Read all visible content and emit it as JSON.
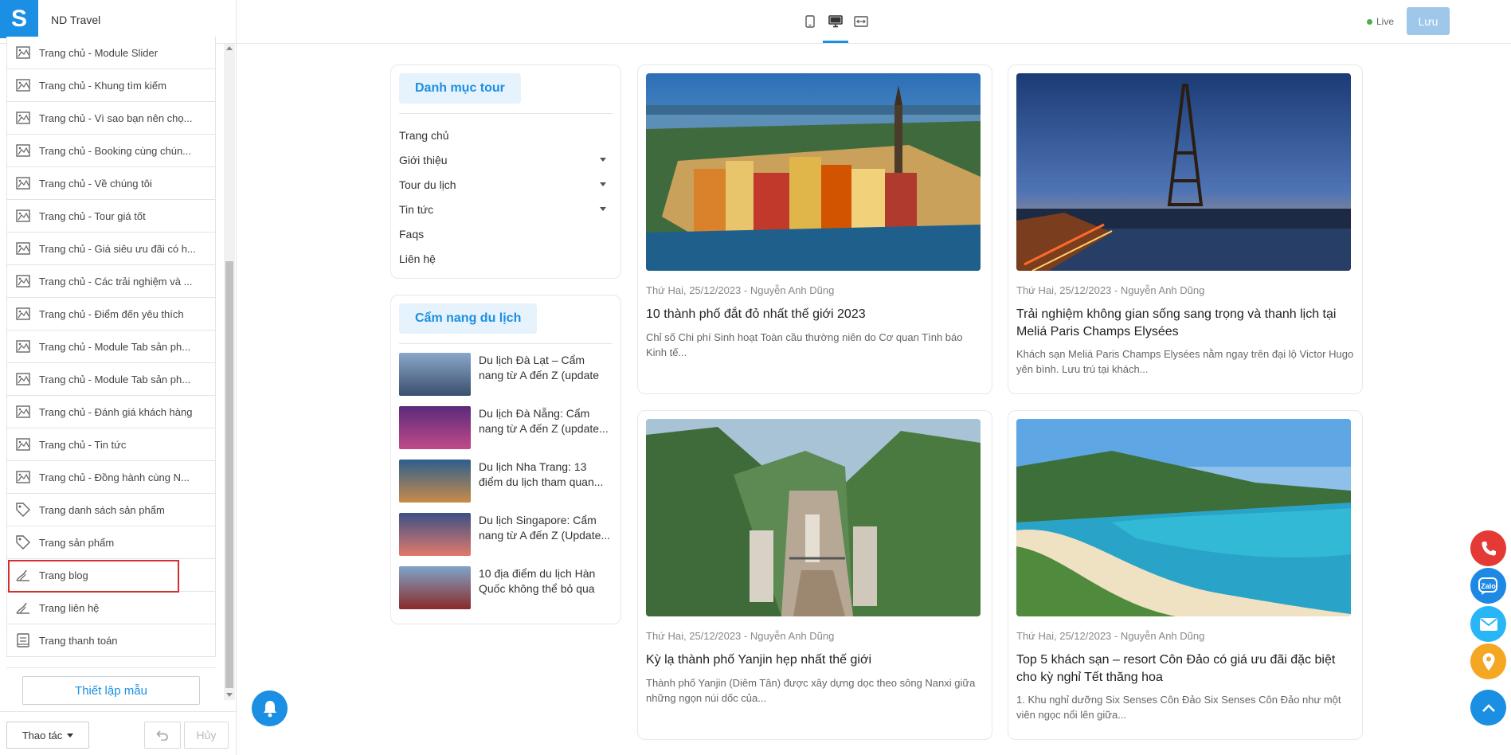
{
  "app": {
    "name": "ND Travel",
    "logo_letter": "S",
    "live_label": "Live",
    "save_label": "Lưu"
  },
  "sidebar": {
    "items": [
      {
        "label": "Trang chủ - Module Slider",
        "icon": "image-icon"
      },
      {
        "label": "Trang chủ - Khung tìm kiếm",
        "icon": "image-icon"
      },
      {
        "label": "Trang chủ - Vì sao bạn nên chọ...",
        "icon": "image-icon"
      },
      {
        "label": "Trang chủ - Booking cùng chún...",
        "icon": "image-icon"
      },
      {
        "label": "Trang chủ - Về chúng tôi",
        "icon": "image-icon"
      },
      {
        "label": "Trang chủ - Tour giá tốt",
        "icon": "image-icon"
      },
      {
        "label": "Trang chủ - Giá siêu ưu đãi có h...",
        "icon": "image-icon"
      },
      {
        "label": "Trang chủ - Các trải nghiệm và ...",
        "icon": "image-icon"
      },
      {
        "label": "Trang chủ - Điểm đến yêu thích",
        "icon": "image-icon"
      },
      {
        "label": "Trang chủ - Module Tab sản ph...",
        "icon": "image-icon"
      },
      {
        "label": "Trang chủ - Module Tab sản ph...",
        "icon": "image-icon"
      },
      {
        "label": "Trang chủ - Đánh giá khách hàng",
        "icon": "image-icon"
      },
      {
        "label": "Trang chủ - Tin tức",
        "icon": "image-icon"
      },
      {
        "label": "Trang chủ - Đồng hành cùng N...",
        "icon": "image-icon"
      },
      {
        "label": "Trang danh sách sản phẩm",
        "icon": "tag-icon"
      },
      {
        "label": "Trang sản phẩm",
        "icon": "tag-icon"
      },
      {
        "label": "Trang blog",
        "icon": "blog-icon",
        "selected": true
      },
      {
        "label": "Trang liên hệ",
        "icon": "blog-icon"
      },
      {
        "label": "Trang thanh toán",
        "icon": "payment-icon"
      }
    ],
    "setup_label": "Thiết lập mẫu",
    "action_label": "Thao tác",
    "cancel_label": "Hủy"
  },
  "tour_menu": {
    "title": "Danh mục tour",
    "items": [
      {
        "label": "Trang chủ",
        "has_submenu": false
      },
      {
        "label": "Giới thiệu",
        "has_submenu": true
      },
      {
        "label": "Tour du lịch",
        "has_submenu": true
      },
      {
        "label": "Tin tức",
        "has_submenu": true
      },
      {
        "label": "Faqs",
        "has_submenu": false
      },
      {
        "label": "Liên hệ",
        "has_submenu": false
      }
    ]
  },
  "travel_guide": {
    "title": "Cẩm nang du lịch",
    "items": [
      {
        "title": "Du lịch Đà Lạt – Cẩm nang từ A đến Z (update thông..."
      },
      {
        "title": "Du lịch Đà Nẵng: Cẩm nang từ A đến Z (update..."
      },
      {
        "title": "Du lịch Nha Trang: 13 điểm du lịch tham quan..."
      },
      {
        "title": "Du lịch Singapore: Cẩm nang từ A đến Z (Update..."
      },
      {
        "title": "10 địa điểm du lịch Hàn Quốc không thể bỏ qua"
      }
    ]
  },
  "posts": [
    {
      "meta": "Thứ Hai, 25/12/2023 - Nguyễn Anh Dũng",
      "title": "10 thành phố đắt đỏ nhất thế giới 2023",
      "excerpt": "Chỉ số Chi phí Sinh hoạt Toàn cầu thường niên do Cơ quan Tình báo Kinh tế..."
    },
    {
      "meta": "Thứ Hai, 25/12/2023 - Nguyễn Anh Dũng",
      "title": "Trải nghiệm không gian sống sang trọng và thanh lịch tại Meliá Paris Champs Elysées",
      "excerpt": "Khách sạn Meliá Paris Champs Elysées nằm ngay trên đại lộ Victor Hugo yên bình. Lưu trú tại khách..."
    },
    {
      "meta": "Thứ Hai, 25/12/2023 - Nguyễn Anh Dũng",
      "title": "Kỳ lạ thành phố Yanjin hẹp nhất thế giới",
      "excerpt": "Thành phố Yanjin (Diêm Tân) được xây dựng dọc theo sông Nanxi giữa những ngọn núi dốc của..."
    },
    {
      "meta": "Thứ Hai, 25/12/2023 - Nguyễn Anh Dũng",
      "title": "Top 5 khách sạn – resort Côn Đảo có giá ưu đãi đặc biệt cho kỳ nghỉ Tết thăng hoa",
      "excerpt": "1. Khu nghỉ dưỡng Six Senses Côn Đảo Six Senses Côn Đảo như một viên ngọc nổi lên giữa..."
    }
  ],
  "floating_buttons": {
    "zalo_label": "Zalo"
  },
  "colors": {
    "accent": "#1a8fe3",
    "selected_outline": "#d32f2f",
    "phone": "#e53935",
    "zalo": "#1e88e5",
    "mail": "#29b6f6",
    "map": "#f5a623"
  }
}
